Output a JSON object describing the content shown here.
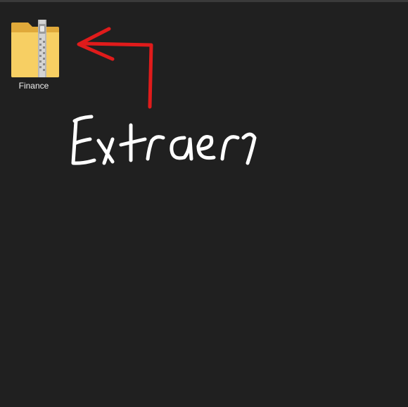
{
  "explorer": {
    "items": [
      {
        "name": "Finance",
        "type": "compressed-zip-folder",
        "icon": "zip-folder-icon"
      }
    ]
  },
  "annotation": {
    "handwritten_text": "Extraer",
    "arrow_color": "#e01b1b",
    "text_color": "#ffffff"
  },
  "theme": {
    "background": "#202020",
    "folder_color": "#f5c84c"
  }
}
